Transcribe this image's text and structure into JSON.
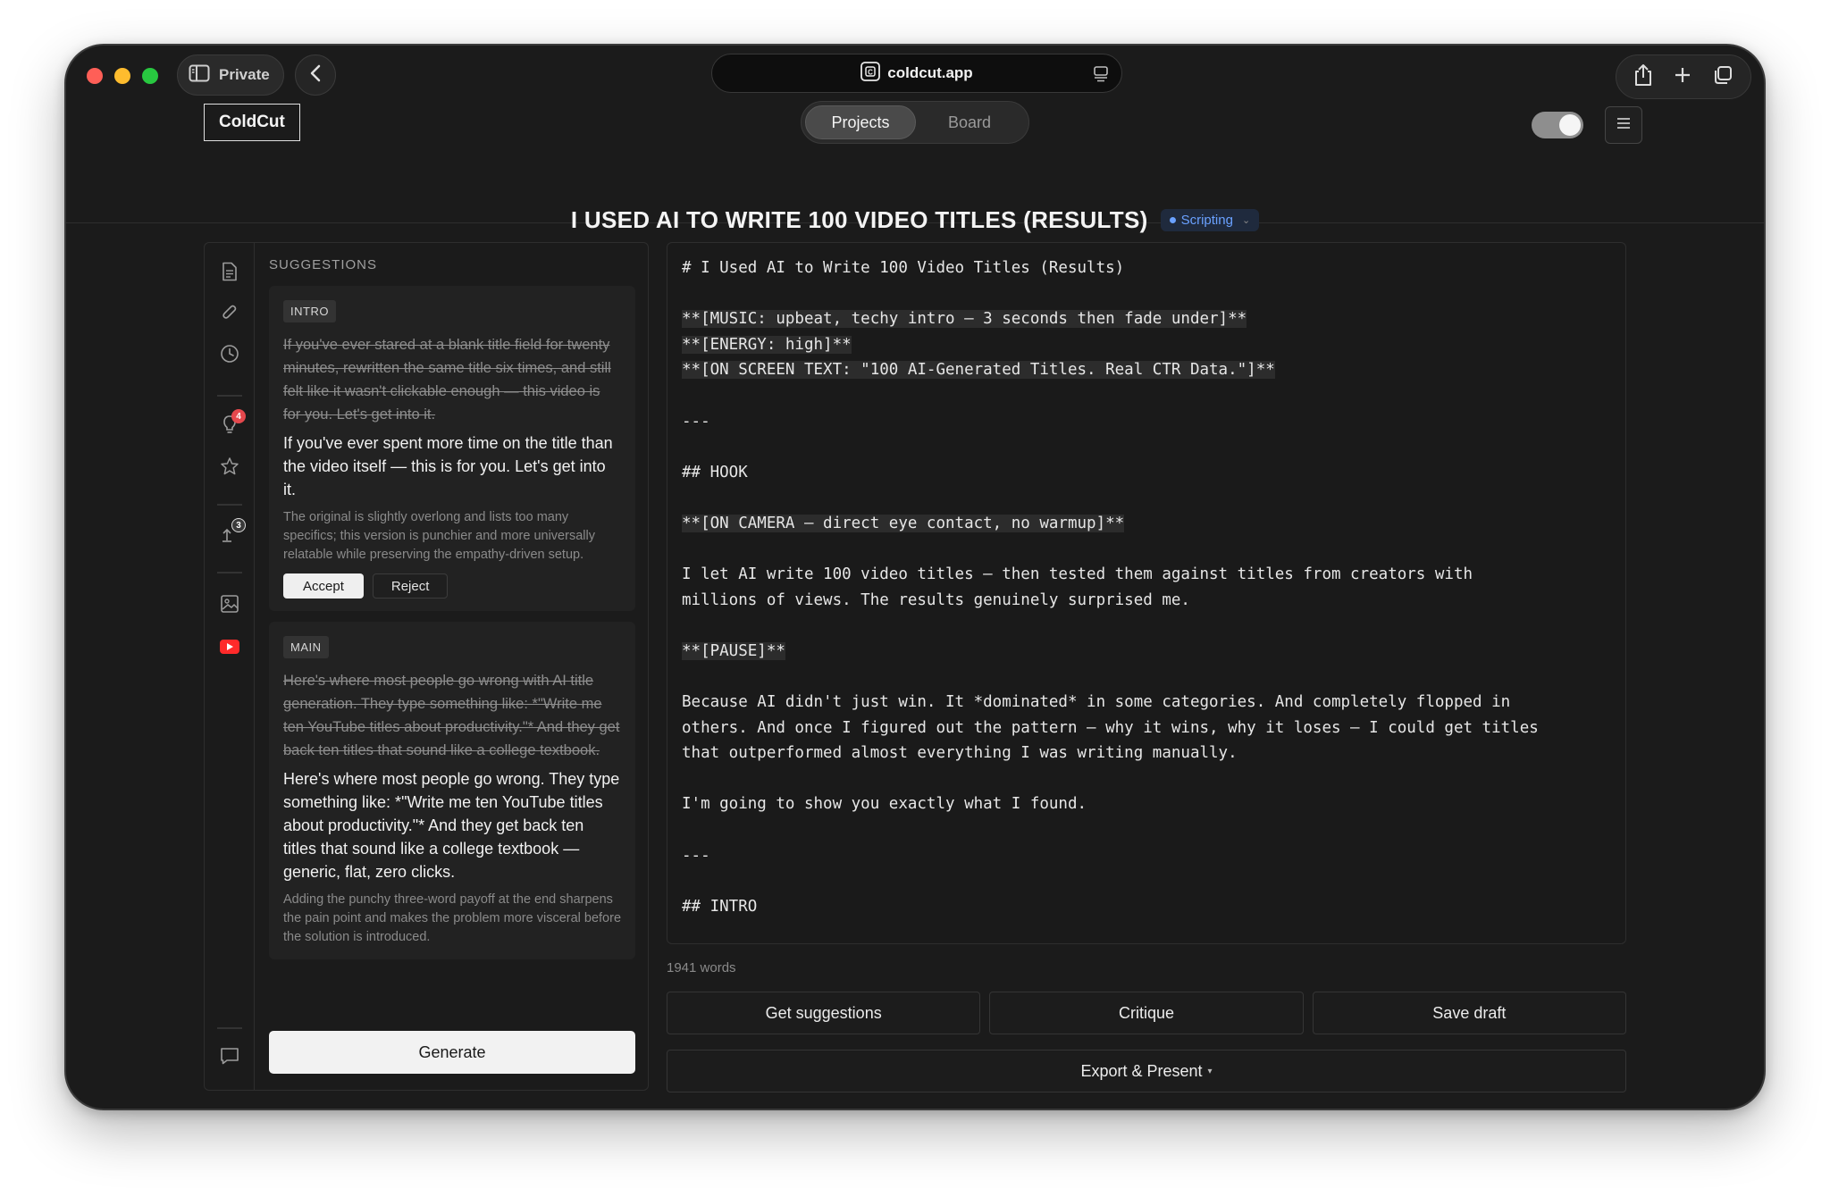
{
  "browser": {
    "private_label": "Private",
    "url": "coldcut.app"
  },
  "app": {
    "logo": "ColdCut",
    "tabs": [
      {
        "label": "Projects",
        "active": true
      },
      {
        "label": "Board",
        "active": false
      }
    ],
    "theme_toggle_on": true
  },
  "document": {
    "title": "I USED AI TO WRITE 100 VIDEO TITLES (RESULTS)",
    "status": "Scripting",
    "status_color": "#6aa1ff"
  },
  "rail": {
    "icons": [
      "document-icon",
      "paperclip-icon",
      "clock-icon",
      "lightbulb-icon",
      "star-icon",
      "upload-icon",
      "image-icon",
      "youtube-icon",
      "comment-icon"
    ],
    "lightbulb_badge": "4",
    "upload_badge": "3",
    "lightbulb_badge_color": "#e5484d",
    "upload_badge_color": "#3a3a3a"
  },
  "suggestions": {
    "header": "SUGGESTIONS",
    "cards": [
      {
        "tag": "INTRO",
        "old": "If you've ever stared at a blank title field for twenty minutes, rewritten the same title six times, and still felt like it wasn't clickable enough — this video is for you. Let's get into it.",
        "new": "If you've ever spent more time on the title than the video itself — this is for you. Let's get into it.",
        "reason": "The original is slightly overlong and lists too many specifics; this version is punchier and more universally relatable while preserving the empathy-driven setup.",
        "accept_label": "Accept",
        "reject_label": "Reject"
      },
      {
        "tag": "MAIN",
        "old": "Here's where most people go wrong with AI title generation. They type something like: *\"Write me ten YouTube titles about productivity.\"* And they get back ten titles that sound like a college textbook.",
        "new": "Here's where most people go wrong. They type something like: *\"Write me ten YouTube titles about productivity.\"* And they get back ten titles that sound like a college textbook — generic, flat, zero clicks.",
        "reason": "Adding the punchy three-word payoff at the end sharpens the pain point and makes the problem more visceral before the solution is introduced."
      }
    ],
    "generate_label": "Generate"
  },
  "editor": {
    "lines": [
      {
        "text": "# I Used AI to Write 100 Video Titles (Results)",
        "hl": false
      },
      {
        "text": "",
        "hl": false
      },
      {
        "text": "**[MUSIC: upbeat, techy intro — 3 seconds then fade under]**",
        "hl": true
      },
      {
        "text": "**[ENERGY: high]**",
        "hl": true
      },
      {
        "text": "**[ON SCREEN TEXT: \"100 AI-Generated Titles. Real CTR Data.\"]**",
        "hl": true
      },
      {
        "text": "",
        "hl": false
      },
      {
        "text": "---",
        "hl": false
      },
      {
        "text": "",
        "hl": false
      },
      {
        "text": "## HOOK",
        "hl": false
      },
      {
        "text": "",
        "hl": false
      },
      {
        "text": "**[ON CAMERA — direct eye contact, no warmup]**",
        "hl": true
      },
      {
        "text": "",
        "hl": false
      },
      {
        "text": "I let AI write 100 video titles — then tested them against titles from creators with",
        "hl": false
      },
      {
        "text": "millions of views. The results genuinely surprised me.",
        "hl": false
      },
      {
        "text": "",
        "hl": false
      },
      {
        "text": "**[PAUSE]**",
        "hl": true
      },
      {
        "text": "",
        "hl": false
      },
      {
        "text": "Because AI didn't just win. It *dominated* in some categories. And completely flopped in",
        "hl": false
      },
      {
        "text": "others. And once I figured out the pattern — why it wins, why it loses — I could get titles",
        "hl": false
      },
      {
        "text": "that outperformed almost everything I was writing manually.",
        "hl": false
      },
      {
        "text": "",
        "hl": false
      },
      {
        "text": "I'm going to show you exactly what I found.",
        "hl": false
      },
      {
        "text": "",
        "hl": false
      },
      {
        "text": "---",
        "hl": false
      },
      {
        "text": "",
        "hl": false
      },
      {
        "text": "## INTRO",
        "hl": false
      }
    ],
    "word_count": "1941 words"
  },
  "actions": {
    "get_suggestions": "Get suggestions",
    "critique": "Critique",
    "save_draft": "Save draft",
    "export": "Export & Present"
  }
}
